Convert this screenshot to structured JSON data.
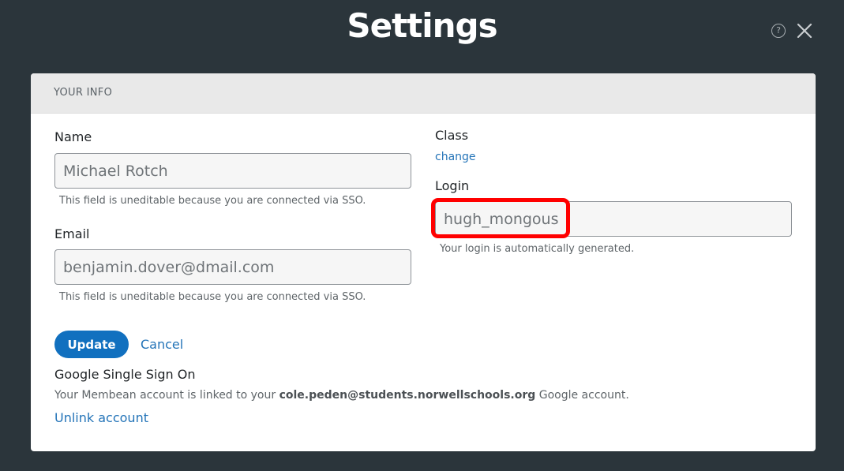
{
  "header": {
    "title": "Settings",
    "help_icon": "help-circle-icon",
    "help_glyph": "?",
    "close_icon": "close-icon"
  },
  "card": {
    "section_title": "YOUR INFO",
    "name": {
      "label": "Name",
      "value": "Michael Rotch",
      "hint": "This field is uneditable because you are connected via SSO."
    },
    "email": {
      "label": "Email",
      "value": "benjamin.dover@dmail.com",
      "hint": "This field is uneditable because you are connected via SSO."
    },
    "class": {
      "label": "Class",
      "change_link": "change"
    },
    "login": {
      "label": "Login",
      "value": "hugh_mongous",
      "hint": "Your login is automatically generated."
    },
    "update_button": "Update",
    "cancel_link": "Cancel",
    "sso": {
      "title": "Google Single Sign On",
      "text_prefix": "Your Membean account is linked to your ",
      "account": "cole.peden@students.norwellschools.org",
      "text_suffix": " Google account.",
      "unlink_link": "Unlink account"
    }
  },
  "colors": {
    "background": "#2b353b",
    "accent": "#1170bf",
    "link": "#2474b8",
    "annotation": "#ff0000"
  }
}
